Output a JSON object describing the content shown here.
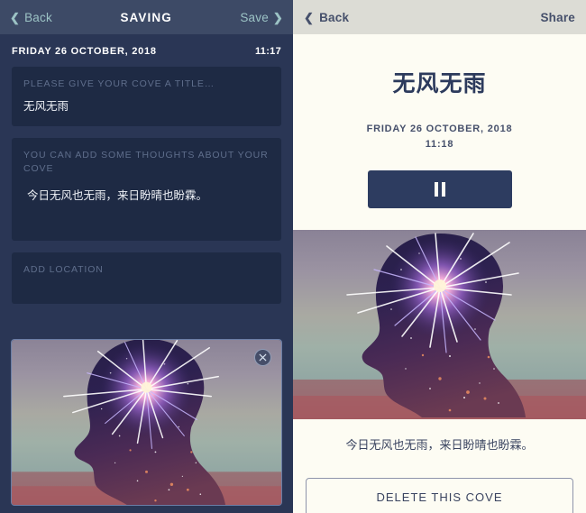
{
  "left_screen": {
    "navbar": {
      "back_label": "Back",
      "back_chevron": "chevron-left-icon",
      "title": "SAVING",
      "save_label": "Save",
      "save_chevron": "chevron-right-icon",
      "link_color": "#9cc3c5",
      "bar_color": "#3d4a66"
    },
    "meta": {
      "date": "FRIDAY 26 OCTOBER, 2018",
      "time": "11:17"
    },
    "fields": [
      {
        "name": "title",
        "placeholder": "PLEASE GIVE YOUR COVE A TITLE…",
        "value": "无风无雨"
      },
      {
        "name": "thoughts",
        "placeholder": "YOU CAN ADD SOME THOUGHTS ABOUT YOUR COVE",
        "value": "今日无风也无雨，来日盼晴也盼霖。"
      },
      {
        "name": "location",
        "placeholder": "ADD LOCATION",
        "value": ""
      }
    ],
    "photo": {
      "alt": "silhouette of a head with a firework burst inside, over a hazy seascape",
      "remove_icon": "close-icon"
    },
    "background_color": "#2a3655",
    "card_color": "#1e2a44"
  },
  "right_screen": {
    "navbar": {
      "back_label": "Back",
      "back_chevron": "chevron-left-icon",
      "share_label": "Share",
      "bar_color": "#dcdcd5"
    },
    "title": "无风无雨",
    "date": "FRIDAY 26 OCTOBER, 2018",
    "time": "11:18",
    "player": {
      "icon": "pause-icon",
      "button_color": "#2d3c60"
    },
    "photo": {
      "alt": "silhouette of a head with a firework burst inside, over a hazy seascape"
    },
    "caption": "今日无风也无雨，来日盼晴也盼霖。",
    "delete_label": "DELETE THIS COVE",
    "background_color": "#fdfcf3"
  }
}
